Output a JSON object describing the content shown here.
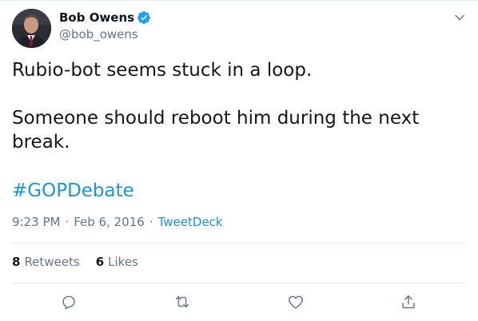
{
  "author": {
    "name": "Bob Owens",
    "handle": "@bob_owens",
    "verified": true,
    "avatar_icon": "profile-photo"
  },
  "tweet": {
    "text": "Rubio-bot seems stuck in a loop.\n\nSomeone should reboot him during the next break.",
    "hashtag": "#GOPDebate",
    "time": "9:23 PM",
    "date": "Feb 6, 2016",
    "separator": "·",
    "source": "TweetDeck"
  },
  "stats": {
    "retweets_count": "8",
    "retweets_label": "Retweets",
    "likes_count": "6",
    "likes_label": "Likes"
  },
  "actions": [
    "reply-icon",
    "retweet-icon",
    "like-icon",
    "share-icon"
  ],
  "colors": {
    "link": "#1b95e0",
    "secondary_text": "#657786",
    "primary_text": "#14171a",
    "divider": "#e6ecf0",
    "verified": "#1da1f2"
  }
}
